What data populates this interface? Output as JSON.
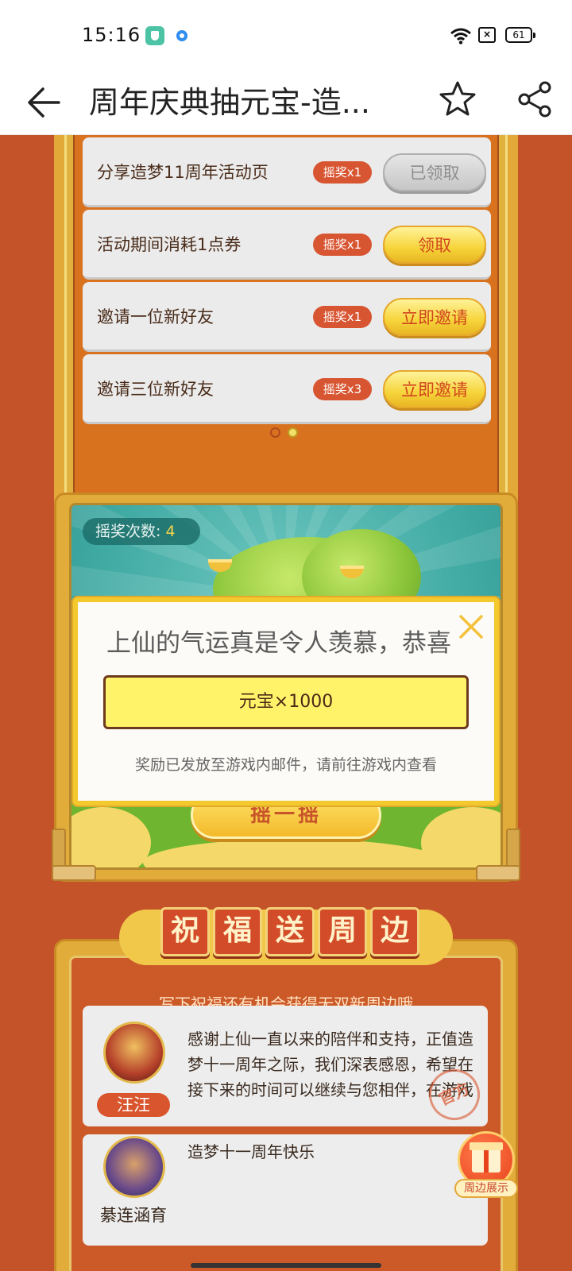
{
  "status_bar": {
    "time": "15:16",
    "battery": "61",
    "icons": [
      "app-shield-icon",
      "app-dot-icon",
      "wifi-icon",
      "sim-icon",
      "battery-icon"
    ]
  },
  "header": {
    "title": "周年庆典抽元宝-造...",
    "icons": [
      "back-arrow-icon",
      "star-icon",
      "share-icon"
    ]
  },
  "tasks": [
    {
      "label": "分享造梦11周年活动页",
      "badge": "摇奖x1",
      "button": "已领取",
      "state": "claimed"
    },
    {
      "label": "活动期间消耗1点券",
      "badge": "摇奖x1",
      "button": "领取",
      "state": "active"
    },
    {
      "label": "邀请一位新好友",
      "badge": "摇奖x1",
      "button": "立即邀请",
      "state": "active"
    },
    {
      "label": "邀请三位新好友",
      "badge": "摇奖x3",
      "button": "立即邀请",
      "state": "active"
    }
  ],
  "lottery": {
    "count_label": "摇奖次数:",
    "count_value": "4",
    "shake_button": "摇一摇"
  },
  "modal": {
    "headline": "上仙的气运真是令人羡慕，恭喜",
    "reward": "元宝×1000",
    "note": "奖励已发放至游戏内邮件，请前往游戏内查看"
  },
  "blessing": {
    "banner": [
      "祝",
      "福",
      "送",
      "周",
      "边"
    ],
    "subtitle": "写下祝福还有机会获得无双新周边哦",
    "messages": [
      {
        "name": "汪汪",
        "text": "感谢上仙一直以来的陪伴和支持，正值造梦十一周年之际，我们深表感恩，希望在接下来的时间可以继续与您相伴，在游戏中收获快乐和",
        "stamp": "官方"
      },
      {
        "name": "綦连涵育",
        "text": "造梦十一周年快乐"
      }
    ],
    "gift_button": "周边展示"
  },
  "colors": {
    "background": "#c4532a",
    "gold": "#f3c92e",
    "reward_fill": "#fff36a"
  }
}
